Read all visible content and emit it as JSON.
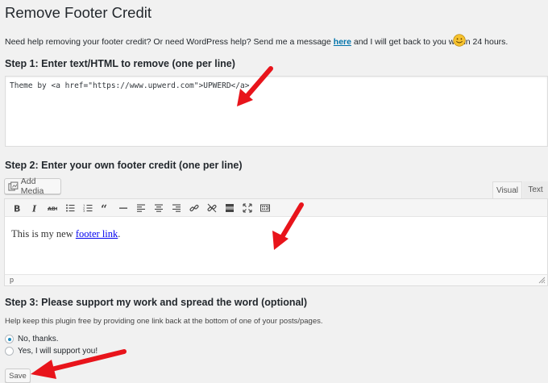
{
  "page": {
    "title": "Remove Footer Credit"
  },
  "help": {
    "before": "Need help removing your footer credit? Or need WordPress help? Send me a message ",
    "link": "here",
    "after": " and I will get back to you within 24 hours."
  },
  "step1": {
    "heading": "Step 1: Enter text/HTML to remove (one per line)",
    "value": "Theme by <a href=\"https://www.upwerd.com\">UPWERD</a>"
  },
  "step2": {
    "heading": "Step 2: Enter your own footer credit (one per line)",
    "add_media_label": "Add Media",
    "tabs": {
      "visual": "Visual",
      "text": "Text"
    },
    "content_before": "This is my new ",
    "content_link": "footer link",
    "content_after": ".",
    "status_path": "p"
  },
  "step3": {
    "heading": "Step 3: Please support my work and spread the word (optional)",
    "description": "Help keep this plugin free by providing one link back at the bottom of one of your posts/pages.",
    "options": [
      {
        "label": "No, thanks.",
        "checked": true
      },
      {
        "label": "Yes, I will support you!",
        "checked": false
      }
    ]
  },
  "save_label": "Save",
  "colors": {
    "annotation_arrow": "#e8141b",
    "radio_checked": "#1e8cbe",
    "link": "#0073aa"
  },
  "toolbar_icons": [
    "bold-icon",
    "italic-icon",
    "strikethrough-icon",
    "bullet-list-icon",
    "numbered-list-icon",
    "blockquote-icon",
    "horizontal-rule-icon",
    "align-left-icon",
    "align-center-icon",
    "align-right-icon",
    "link-icon",
    "unlink-icon",
    "read-more-icon",
    "fullscreen-icon",
    "toolbar-toggle-icon"
  ]
}
